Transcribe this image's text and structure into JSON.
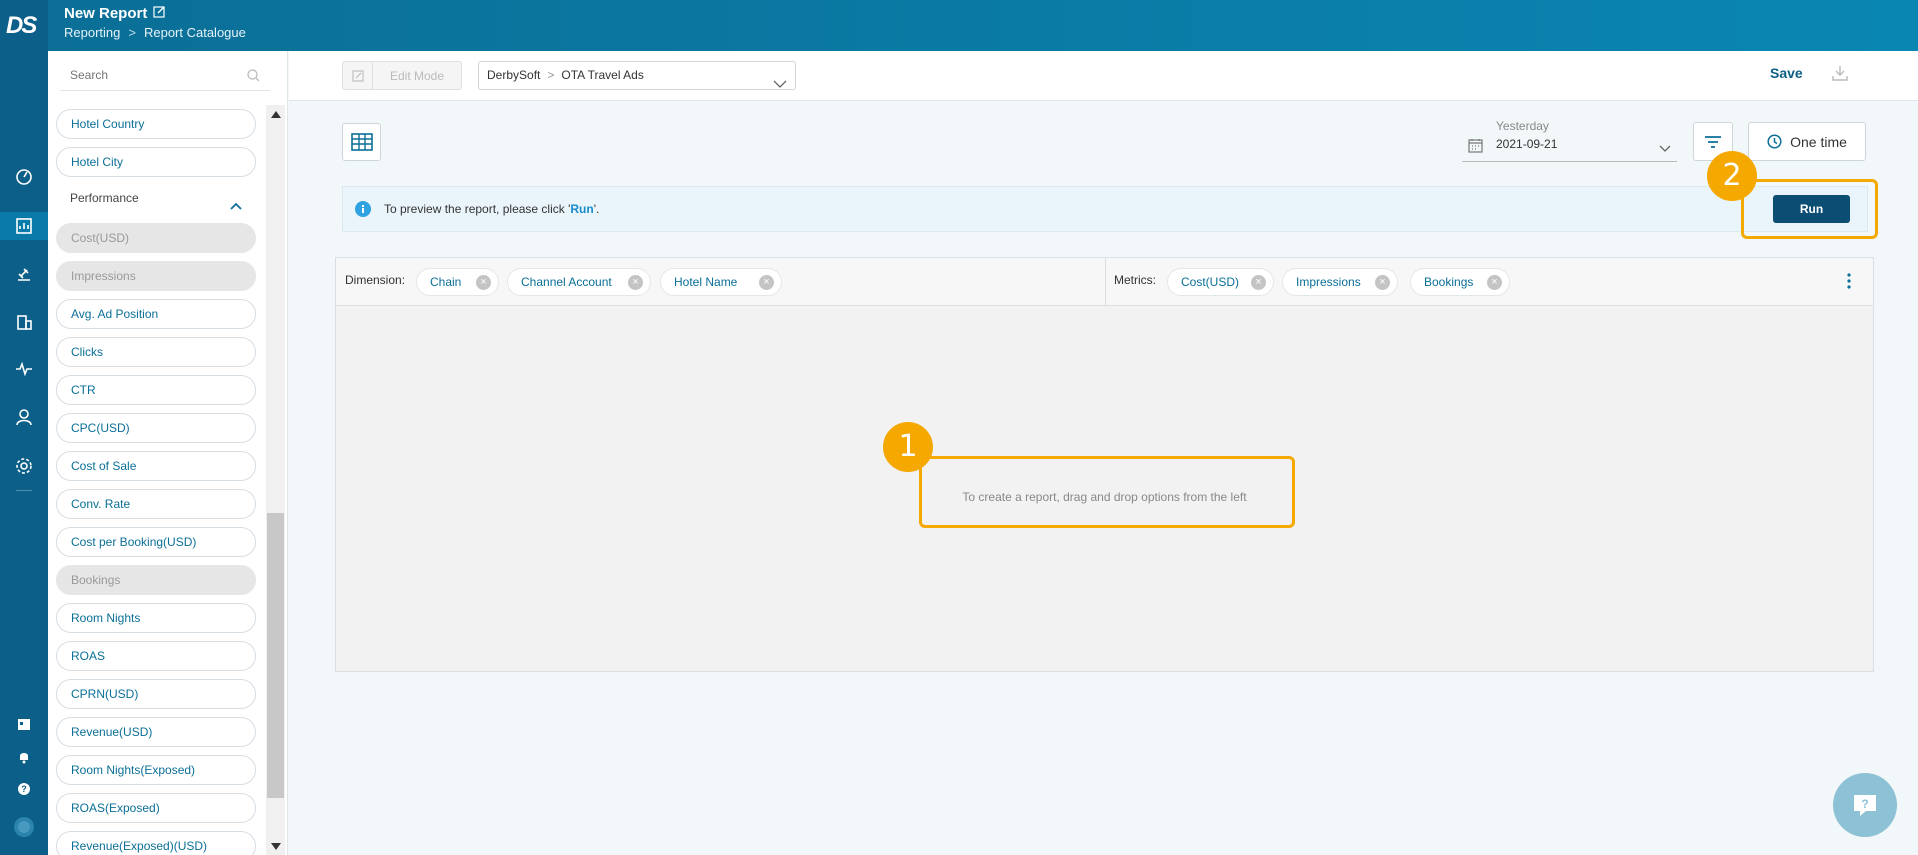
{
  "app": {
    "logo": "DS",
    "title": "New Report",
    "breadcrumb": [
      "Reporting",
      "Report Catalogue"
    ],
    "breadcrumb_sep": ">"
  },
  "rail_icons": [
    "dashboard-icon",
    "report-icon",
    "auction-icon",
    "building-icon",
    "activity-icon",
    "user-icon",
    "settings-icon",
    "calendar-icon",
    "bell-icon",
    "help-icon",
    "avatar"
  ],
  "sidebar": {
    "search_placeholder": "Search",
    "items": [
      {
        "label": "Hotel Country",
        "disabled": false
      },
      {
        "label": "Hotel City",
        "disabled": false
      }
    ],
    "section": "Performance",
    "performance_items": [
      {
        "label": "Cost(USD)",
        "disabled": true
      },
      {
        "label": "Impressions",
        "disabled": true
      },
      {
        "label": "Avg. Ad Position",
        "disabled": false
      },
      {
        "label": "Clicks",
        "disabled": false
      },
      {
        "label": "CTR",
        "disabled": false
      },
      {
        "label": "CPC(USD)",
        "disabled": false
      },
      {
        "label": "Cost of Sale",
        "disabled": false
      },
      {
        "label": "Conv. Rate",
        "disabled": false
      },
      {
        "label": "Cost per Booking(USD)",
        "disabled": false
      },
      {
        "label": "Bookings",
        "disabled": true
      },
      {
        "label": "Room Nights",
        "disabled": false
      },
      {
        "label": "ROAS",
        "disabled": false
      },
      {
        "label": "CPRN(USD)",
        "disabled": false
      },
      {
        "label": "Revenue(USD)",
        "disabled": false
      },
      {
        "label": "Room Nights(Exposed)",
        "disabled": false
      },
      {
        "label": "ROAS(Exposed)",
        "disabled": false
      },
      {
        "label": "Revenue(Exposed)(USD)",
        "disabled": false
      }
    ]
  },
  "toolbar": {
    "edit_mode": "Edit Mode",
    "selector": {
      "account": "DerbySoft",
      "sep": ">",
      "product": "OTA Travel Ads"
    },
    "save": "Save"
  },
  "date": {
    "label": "Yesterday",
    "value": "2021-09-21"
  },
  "schedule": "One time",
  "notice": {
    "prefix": "To preview the report, please click '",
    "action": "Run",
    "suffix": "'."
  },
  "run": "Run",
  "dimension": {
    "label": "Dimension:",
    "chips": [
      "Chain",
      "Channel Account",
      "Hotel Name"
    ]
  },
  "metrics": {
    "label": "Metrics:",
    "chips": [
      "Cost(USD)",
      "Impressions",
      "Bookings"
    ]
  },
  "empty_message": "To create a report, drag and drop options from the left",
  "callouts": [
    "1",
    "2"
  ],
  "colors": {
    "brand": "#0b6f97",
    "run": "#0b4d73",
    "highlight": "#f5a800"
  }
}
